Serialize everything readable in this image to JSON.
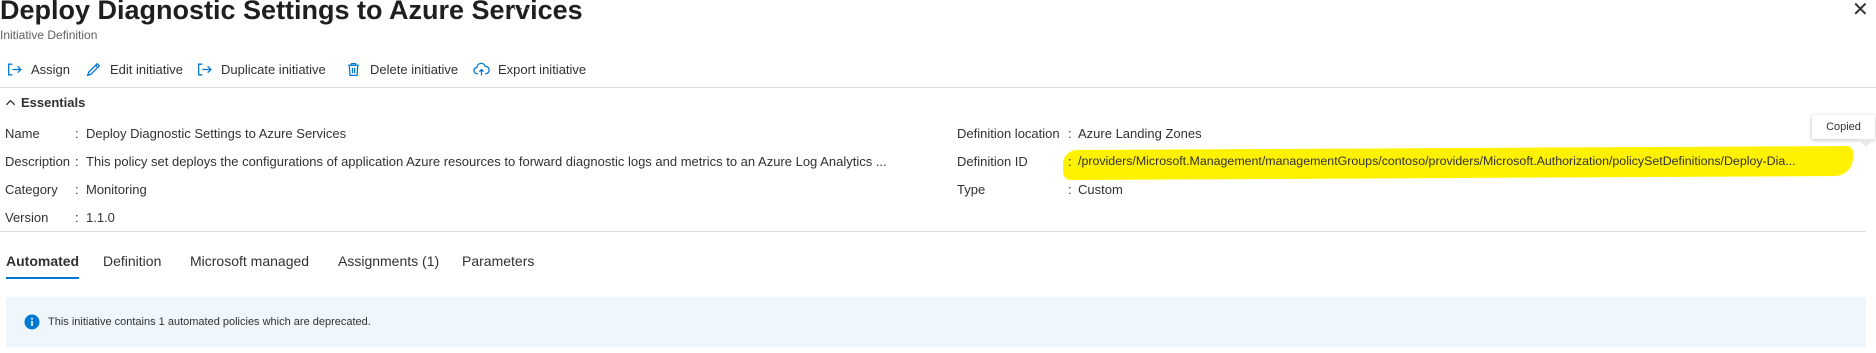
{
  "header": {
    "title": "Deploy Diagnostic Settings to Azure Services",
    "subtitle": "Initiative Definition",
    "more_label": "···",
    "close_label": "✕"
  },
  "toolbar": {
    "assign": "Assign",
    "edit": "Edit initiative",
    "duplicate": "Duplicate initiative",
    "delete": "Delete initiative",
    "export": "Export initiative"
  },
  "essentials": {
    "toggle_label": "Essentials",
    "separator": ":",
    "name_label": "Name",
    "name_value": "Deploy Diagnostic Settings to Azure Services",
    "description_label": "Description",
    "description_value": "This policy set deploys the configurations of application Azure resources to forward diagnostic logs and metrics to an Azure Log Analytics ...",
    "category_label": "Category",
    "category_value": "Monitoring",
    "version_label": "Version",
    "version_value": "1.1.0",
    "location_label": "Definition location",
    "location_value": "Azure Landing Zones",
    "id_label": "Definition ID",
    "id_value": "/providers/Microsoft.Management/managementGroups/contoso/providers/Microsoft.Authorization/policySetDefinitions/Deploy-Dia...",
    "type_label": "Type",
    "type_value": "Custom"
  },
  "tooltip": {
    "copied": "Copied"
  },
  "tabs": [
    {
      "label": "Automated"
    },
    {
      "label": "Definition"
    },
    {
      "label": "Microsoft managed"
    },
    {
      "label": "Assignments (1)"
    },
    {
      "label": "Parameters"
    }
  ],
  "info": {
    "message": "This initiative contains 1 automated policies which are deprecated."
  },
  "colors": {
    "accent": "#0078d4",
    "highlight": "#fff200",
    "info_background": "#eff6fc"
  }
}
